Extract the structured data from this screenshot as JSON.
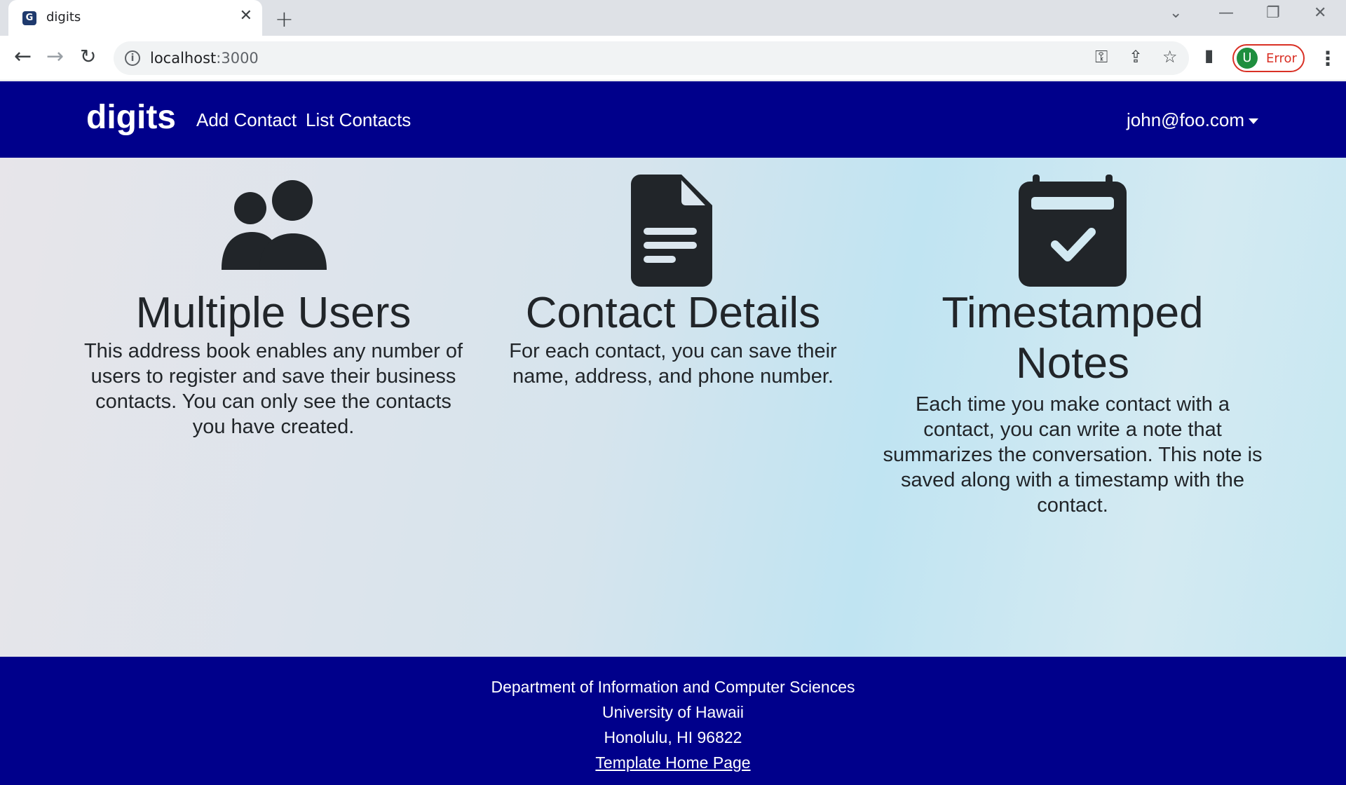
{
  "browser": {
    "tab_title": "digits",
    "url_host": "localhost",
    "url_port": ":3000",
    "profile_initial": "U",
    "profile_status": "Error"
  },
  "navbar": {
    "brand": "digits",
    "links": [
      "Add Contact",
      "List Contacts"
    ],
    "user": "john@foo.com"
  },
  "features": [
    {
      "icon": "people-icon",
      "title": "Multiple Users",
      "text": "This address book enables any number of users to register and save their business contacts. You can only see the contacts you have created."
    },
    {
      "icon": "file-text-icon",
      "title": "Contact Details",
      "text": "For each contact, you can save their name, address, and phone number."
    },
    {
      "icon": "calendar-check-icon",
      "title": "Timestamped Notes",
      "text": "Each time you make contact with a contact, you can write a note that summarizes the conversation. This note is saved along with a timestamp with the contact."
    }
  ],
  "footer": {
    "lines": [
      "Department of Information and Computer Sciences",
      "University of Hawaii",
      "Honolulu, HI 96822"
    ],
    "link": "Template Home Page"
  },
  "colors": {
    "navbar_bg": "#00008b",
    "text_dark": "#212529",
    "profile_error": "#d93025"
  }
}
